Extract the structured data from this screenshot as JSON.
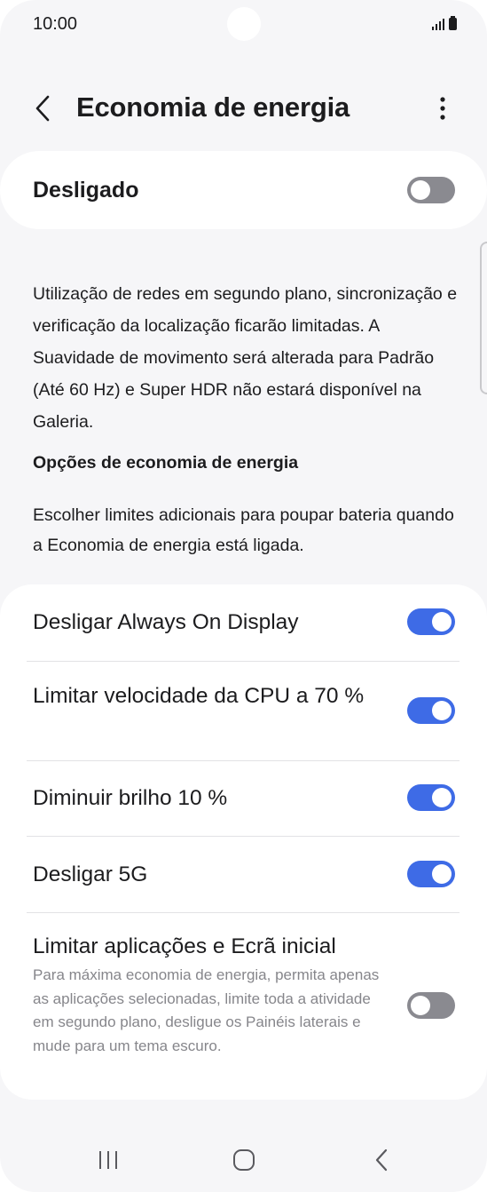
{
  "status_bar": {
    "time": "10:00"
  },
  "header": {
    "title": "Economia de energia",
    "back_icon": "chevron-left-icon",
    "more_icon": "more-vertical-icon"
  },
  "master_switch": {
    "label": "Desligado",
    "on": false
  },
  "description": "Utilização de redes em segundo plano, sincronização e verificação da localização ficarão limitadas. A Suavidade de movimento será alterada para Padrão (Até 60 Hz) e Super HDR não estará disponível na Galeria.",
  "section": {
    "title": "Opções de economia de energia",
    "description": "Escolher limites adicionais para poupar bateria quando a Economia de energia está ligada."
  },
  "options": [
    {
      "label": "Desligar Always On Display",
      "on": true
    },
    {
      "label": "Limitar velocidade da CPU a 70 %",
      "on": true
    },
    {
      "label": "Diminuir brilho 10 %",
      "on": true
    },
    {
      "label": "Desligar 5G",
      "on": true
    },
    {
      "label": "Limitar aplicações e Ecrã inicial",
      "subtitle": "Para máxima economia de energia, permita apenas as aplicações selecionadas, limite toda a atividade em segundo plano, desligue os Painéis laterais e mude para um tema escuro.",
      "on": false
    }
  ],
  "colors": {
    "toggle_on": "#3e6be6",
    "toggle_off": "#8a8a90",
    "background": "#f6f6f8",
    "card": "#ffffff"
  },
  "navbar": {
    "recents_icon": "recent-apps-icon",
    "home_icon": "home-icon",
    "back_icon": "back-icon"
  }
}
